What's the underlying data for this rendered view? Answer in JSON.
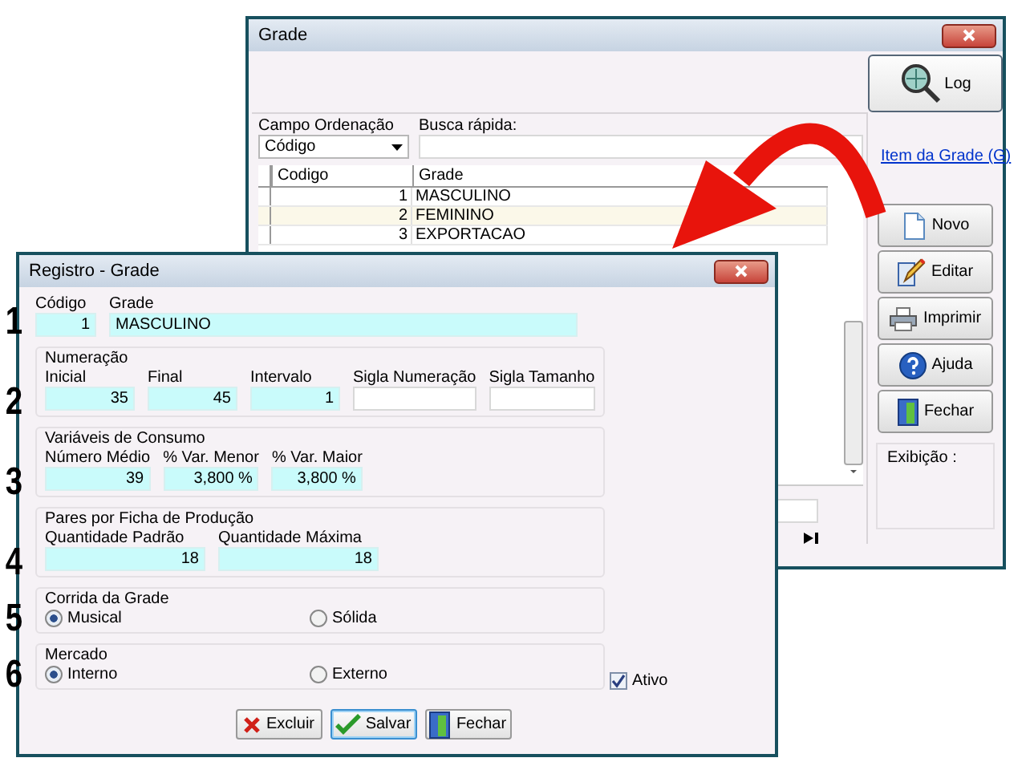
{
  "back_window": {
    "title": "Grade",
    "log_button": "Log",
    "sort_field": {
      "label": "Campo Ordenação",
      "value": "Código"
    },
    "quick_search": {
      "label": "Busca rápida:"
    },
    "table": {
      "columns": [
        "Codigo",
        "Grade"
      ],
      "rows": [
        {
          "codigo": "1",
          "grade": "MASCULINO",
          "selected": false
        },
        {
          "codigo": "2",
          "grade": "FEMININO",
          "selected": true
        },
        {
          "codigo": "3",
          "grade": "EXPORTACAO",
          "selected": false
        }
      ]
    },
    "link": "Item da Grade (G)",
    "buttons": [
      {
        "label": "Novo",
        "kind": "new"
      },
      {
        "label": "Editar",
        "kind": "edit"
      },
      {
        "label": "Imprimir",
        "kind": "print"
      },
      {
        "label": "Ajuda",
        "kind": "help"
      },
      {
        "label": "Fechar",
        "kind": "close"
      }
    ],
    "display_label": "Exibição :"
  },
  "dialog": {
    "title": "Registro - Grade",
    "marker": "1",
    "code": {
      "label": "Código",
      "value": "1"
    },
    "grade": {
      "label": "Grade",
      "value": "MASCULINO"
    },
    "groups": [
      {
        "kind": "fields",
        "marker": "2",
        "title": "Numeração",
        "fields": [
          {
            "label": "Inicial",
            "value": "35",
            "highlighted": true
          },
          {
            "label": "Final",
            "value": "45",
            "highlighted": true
          },
          {
            "label": "Intervalo",
            "value": "1",
            "highlighted": true
          },
          {
            "label": "Sigla Numeração",
            "highlighted": false
          },
          {
            "label": "Sigla Tamanho",
            "highlighted": false
          }
        ]
      },
      {
        "kind": "fields",
        "marker": "3",
        "title": "Variáveis de Consumo",
        "fields": [
          {
            "label": "Número Médio",
            "value": "39",
            "highlighted": true
          },
          {
            "label": "% Var. Menor",
            "value": "3,800 %",
            "highlighted": true
          },
          {
            "label": "% Var. Maior",
            "value": "3,800 %",
            "highlighted": true
          }
        ]
      },
      {
        "kind": "fields",
        "marker": "4",
        "title": "Pares por Ficha de Produção",
        "fields": [
          {
            "label": "Quantidade Padrão",
            "value": "18",
            "highlighted": true
          },
          {
            "label": "Quantidade Máxima",
            "value": "18",
            "highlighted": true
          }
        ]
      },
      {
        "kind": "radios",
        "marker": "5",
        "title": "Corrida da Grade",
        "options": [
          {
            "label": "Musical",
            "selected": true
          },
          {
            "label": "Sólida",
            "selected": false
          }
        ]
      },
      {
        "kind": "radios",
        "marker": "6",
        "title": "Mercado",
        "options": [
          {
            "label": "Interno",
            "selected": true
          },
          {
            "label": "Externo",
            "selected": false
          }
        ]
      }
    ],
    "active": {
      "label": "Ativo",
      "checked": true
    },
    "buttons": [
      {
        "label": "Excluir",
        "kind": "delete",
        "focused": false
      },
      {
        "label": "Salvar",
        "kind": "save",
        "focused": true
      },
      {
        "label": "Fechar",
        "kind": "close",
        "focused": false
      }
    ]
  }
}
